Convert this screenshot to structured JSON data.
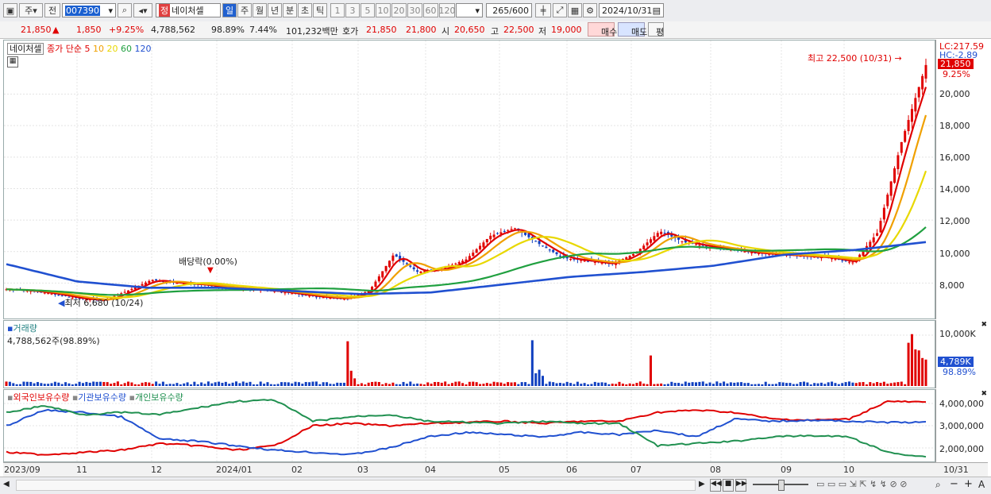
{
  "toolbar": {
    "type1": "주",
    "type2": "전",
    "code": "007390",
    "badge": "정",
    "name": "네이처셀",
    "periods": [
      "일",
      "주",
      "월",
      "년",
      "분",
      "초",
      "틱"
    ],
    "nums": [
      "1",
      "3",
      "5",
      "10",
      "20",
      "30",
      "60",
      "120"
    ],
    "count": "265",
    "total": "/600",
    "date": "2024/10/31"
  },
  "info": {
    "price": "21,850",
    "arrow": "▲",
    "change": "1,850",
    "pct": "+9.25%",
    "volume": "4,788,562",
    "vol_pct": "98.89%",
    "turnover": "7.44%",
    "amount": "101,232백만",
    "quote_label": "호가",
    "ask": "21,850",
    "bid": "21,800",
    "open_label": "시",
    "open": "20,650",
    "high_label": "고",
    "high": "22,500",
    "low_label": "저",
    "low": "19,000",
    "buy": "매수",
    "sell": "매도",
    "avg": "평"
  },
  "price_panel": {
    "legend_name": "네이처셀",
    "legend_ma": "종가 단순",
    "ma_periods": [
      "5",
      "10",
      "20",
      "60",
      "120"
    ],
    "ma_colors": [
      "#e00000",
      "#f0a000",
      "#e8d800",
      "#20a040",
      "#2050d0"
    ],
    "y_ticks": [
      "20,000",
      "18,000",
      "16,000",
      "14,000",
      "12,000",
      "10,000",
      "8,000"
    ],
    "lc": "LC:217.59",
    "hc": "HC:-2.89",
    "last": "21,850",
    "last_pct": "9.25%",
    "high_annot": "최고 22,500 (10/31)",
    "low_annot": "최저 6,680 (10/24)",
    "div_annot": "배당락(0.00%)"
  },
  "volume_panel": {
    "title": "거래량",
    "value": "4,788,562주(98.89%)",
    "y_tick": "10,000K",
    "last": "4,789K",
    "last_pct": "98.89%"
  },
  "holder_panel": {
    "legend": [
      "외국인보유수량",
      "기관보유수량",
      "개인보유수량"
    ],
    "colors": [
      "#e00000",
      "#2050d0",
      "#209050"
    ],
    "y_ticks": [
      "4,000,000",
      "3,000,000",
      "2,000,000"
    ]
  },
  "x_labels": [
    "2023/09",
    "11",
    "12",
    "2024/01",
    "02",
    "03",
    "04",
    "05",
    "06",
    "07",
    "08",
    "09",
    "10",
    "10/31"
  ],
  "chart_data": {
    "type": "line",
    "title": "네이처셀",
    "x": [
      "2023/09",
      "11",
      "12",
      "2024/01",
      "02",
      "03",
      "04",
      "05",
      "06",
      "07",
      "08",
      "09",
      "10",
      "10/31"
    ],
    "series": [
      {
        "name": "종가",
        "values": [
          7600,
          7400,
          7700,
          7900,
          7600,
          7000,
          8800,
          9500,
          11500,
          9400,
          11500,
          10000,
          9800,
          21850
        ]
      },
      {
        "name": "120",
        "values": [
          9200,
          8100,
          7700,
          7700,
          7500,
          7300,
          7400,
          7900,
          8400,
          8700,
          9100,
          9800,
          10100,
          10600
        ]
      }
    ],
    "ylim": [
      6000,
      22500
    ]
  }
}
